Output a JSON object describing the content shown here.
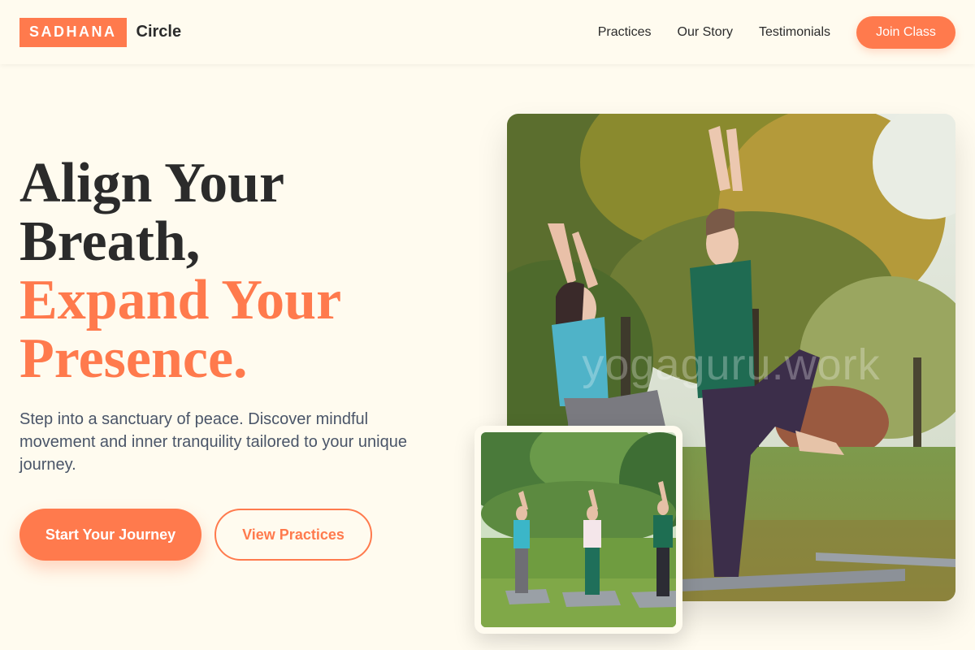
{
  "nav": {
    "brand_box": "SADHANA",
    "brand_text": "Circle",
    "links": [
      "Practices",
      "Our Story",
      "Testimonials"
    ],
    "cta": "Join Class"
  },
  "hero": {
    "headline_line1": "Align Your",
    "headline_line2": "Breath,",
    "headline_line3": "Expand Your",
    "headline_line4": "Presence.",
    "lede": "Step into a sanctuary of peace. Discover mindful movement and inner tranquility tailored to your unique journey.",
    "primary_button": "Start Your Journey",
    "secondary_button": "View Practices",
    "watermark": "yogaguru.work"
  },
  "colors": {
    "accent": "#ff7a4d",
    "background": "#fffbef",
    "text_dark": "#2b2b2b",
    "text_muted": "#4a5568"
  }
}
